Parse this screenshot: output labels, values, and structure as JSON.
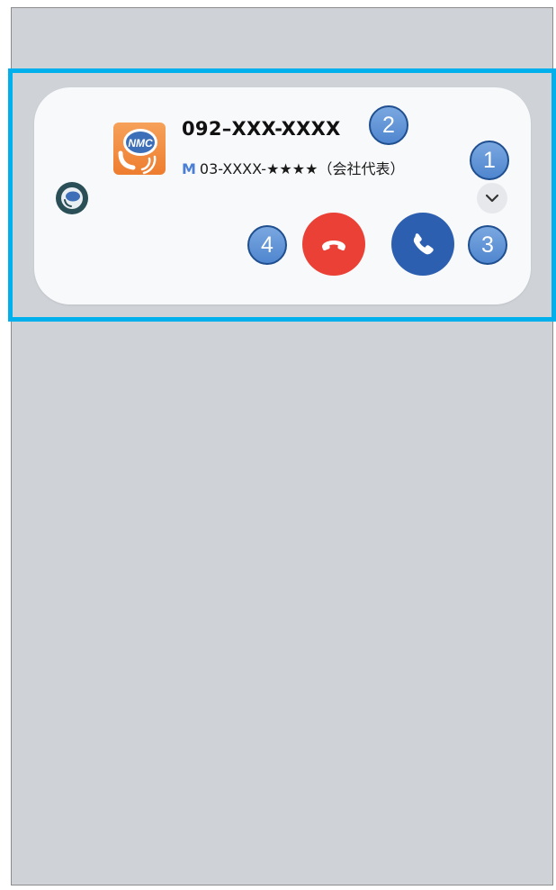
{
  "caller": {
    "number": "092–XXX-XXXX",
    "sub_mark": "M",
    "sub_text": "03-XXXX-★★★★（会社代表）"
  },
  "app": {
    "logo_text": "NMC",
    "logo_icon": "nmc-app-logo",
    "small_icon": "nmc-app-icon"
  },
  "actions": {
    "expand_icon": "chevron-down-icon",
    "decline_icon": "phone-hangup-icon",
    "answer_icon": "phone-icon"
  },
  "callouts": [
    "1",
    "2",
    "3",
    "4"
  ],
  "colors": {
    "screen_bg": "#cfd3d8",
    "highlight": "#00b0ec",
    "card_bg": "#f8f9fa",
    "decline": "#ea4035",
    "answer": "#2c5fb0",
    "callout": "#5a8fd6",
    "sub_mark": "#4a7fd4"
  }
}
